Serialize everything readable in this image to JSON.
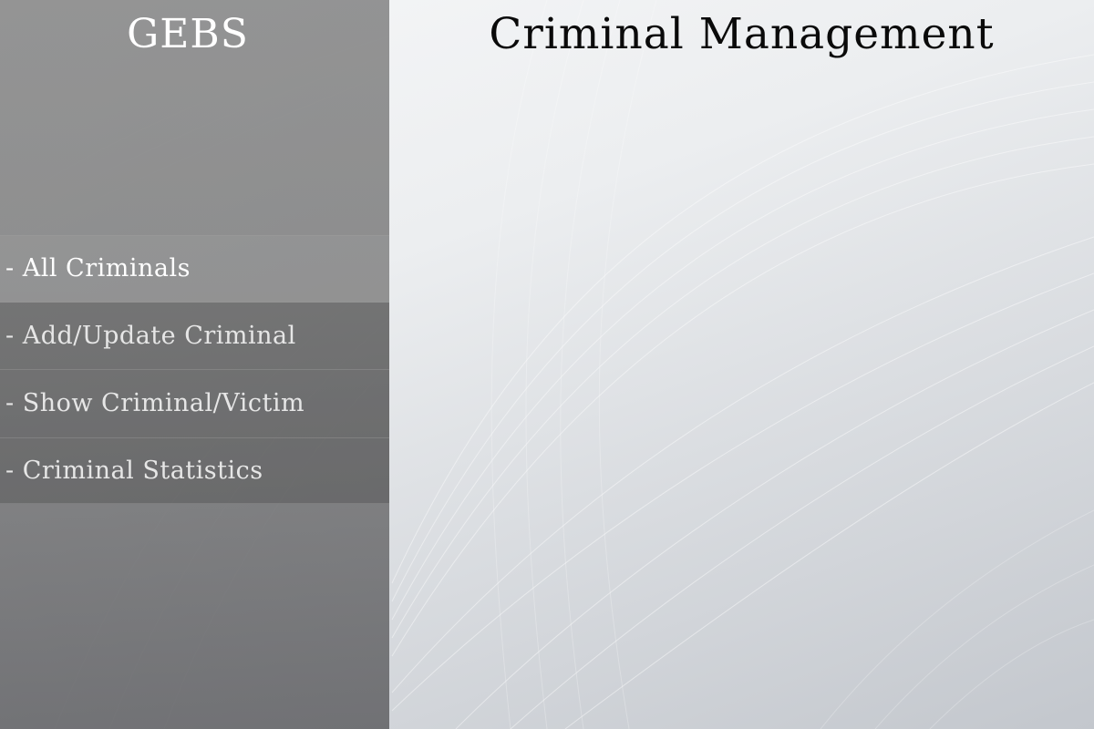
{
  "sidebar": {
    "brand": "GEBS",
    "items": [
      {
        "label": "- All Criminals",
        "active": true
      },
      {
        "label": "- Add/Update Criminal",
        "active": false
      },
      {
        "label": "- Show Criminal/Victim",
        "active": false
      },
      {
        "label": "- Criminal Statistics",
        "active": false
      }
    ]
  },
  "main": {
    "title": "Criminal Management"
  },
  "colors": {
    "background": "#e6e8eb",
    "sidebar": "#6e6e6e",
    "title_text": "#0a0a0a",
    "menu_text": "#ffffff"
  }
}
